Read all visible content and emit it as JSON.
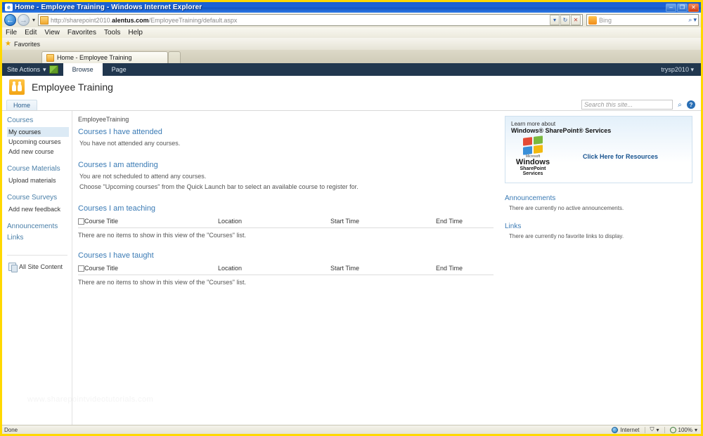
{
  "window": {
    "title": "Home - Employee Training - Windows Internet Explorer",
    "minimize": "–",
    "maximize": "❐",
    "close": "✕"
  },
  "browser": {
    "url_prefix": "http://sharepoint2010.",
    "url_domain": "alentus.com",
    "url_suffix": "/EmployeeTraining/default.aspx",
    "back_glyph": "←",
    "forward_glyph": "→",
    "dropdown_glyph": "▾",
    "refresh_glyph": "↻",
    "stop_glyph": "✕",
    "search_placeholder": "Bing",
    "search_go_glyph": "⌕",
    "menu": [
      "File",
      "Edit",
      "View",
      "Favorites",
      "Tools",
      "Help"
    ],
    "favorites_label": "Favorites",
    "star_glyph": "★",
    "tab_title": "Home - Employee Training",
    "newtab_label": ""
  },
  "sharepoint": {
    "site_actions": "Site Actions",
    "site_actions_caret": "▾",
    "ribbon_tabs": [
      {
        "label": "Browse",
        "active": true
      },
      {
        "label": "Page",
        "active": false
      }
    ],
    "user": "trysp2010",
    "user_caret": "▾",
    "site_title": "Employee Training",
    "home_tab": "Home",
    "search_placeholder": "Search this site...",
    "search_icon_glyph": "⌕",
    "help_icon_glyph": "?"
  },
  "quicklaunch": {
    "groups": [
      {
        "heading": "Courses",
        "items": [
          {
            "label": "My courses",
            "selected": true
          },
          {
            "label": "Upcoming courses",
            "selected": false
          },
          {
            "label": "Add new course",
            "selected": false
          }
        ]
      },
      {
        "heading": "Course Materials",
        "items": [
          {
            "label": "Upload materials",
            "selected": false
          }
        ]
      },
      {
        "heading": "Course Surveys",
        "items": [
          {
            "label": "Add new feedback",
            "selected": false
          }
        ]
      },
      {
        "heading": "Announcements",
        "items": []
      },
      {
        "heading": "Links",
        "items": []
      }
    ],
    "all_site_content": "All Site Content"
  },
  "main": {
    "breadcrumb": "EmployeeTraining",
    "sections": [
      {
        "title": "Courses I have attended",
        "notes": [
          "You have not attended any courses."
        ],
        "table": null
      },
      {
        "title": "Courses I am attending",
        "notes": [
          "You are not scheduled to attend any courses.",
          "Choose \"Upcoming courses\" from the Quick Launch bar to select an available course to register for."
        ],
        "table": null
      },
      {
        "title": "Courses I am teaching",
        "notes": [],
        "table": {
          "columns": [
            "Course Title",
            "Location",
            "Start Time",
            "End Time"
          ],
          "empty_message": "There are no items to show in this view of the \"Courses\" list."
        }
      },
      {
        "title": "Courses I have taught",
        "notes": [],
        "table": {
          "columns": [
            "Course Title",
            "Location",
            "Start Time",
            "End Time"
          ],
          "empty_message": "There are no items to show in this view of the \"Courses\" list."
        }
      }
    ]
  },
  "rightcol": {
    "promo": {
      "line1": "Learn more about",
      "line2": "Windows® SharePoint® Services",
      "logo_ms": "Microsoft",
      "logo_windows": "Windows",
      "logo_sps": "SharePoint Services",
      "cta": "Click Here for Resources"
    },
    "panels": [
      {
        "heading": "Announcements",
        "note": "There are currently no active announcements."
      },
      {
        "heading": "Links",
        "note": "There are currently no favorite links to display."
      }
    ]
  },
  "watermark": "www.sharepointvideotutorials.com",
  "statusbar": {
    "status": "Done",
    "zone": "Internet",
    "protected_glyph": "⛉",
    "zoom": "100%",
    "caret": "▾"
  }
}
